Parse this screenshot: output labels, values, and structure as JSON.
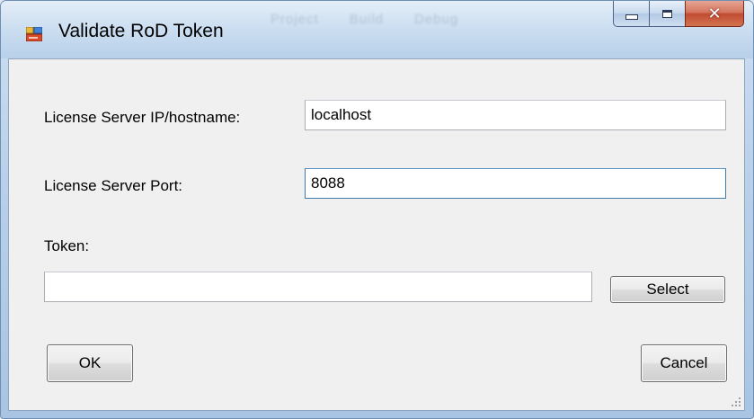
{
  "window": {
    "title": "Validate RoD Token",
    "background_menu": [
      "Project",
      "Build",
      "Debug"
    ]
  },
  "form": {
    "server_label": "License Server IP/hostname:",
    "server_value": "localhost",
    "port_label": "License Server Port:",
    "port_value": "8088",
    "token_label": "Token:",
    "token_value": "",
    "select_label": "Select",
    "ok_label": "OK",
    "cancel_label": "Cancel"
  },
  "colors": {
    "close_button": "#c14c33",
    "client_background": "#f0f0f0",
    "focus_border": "#3d7bad"
  },
  "icons": [
    "app-form-icon",
    "minimize-icon",
    "maximize-icon",
    "close-icon",
    "resize-grip-icon"
  ]
}
